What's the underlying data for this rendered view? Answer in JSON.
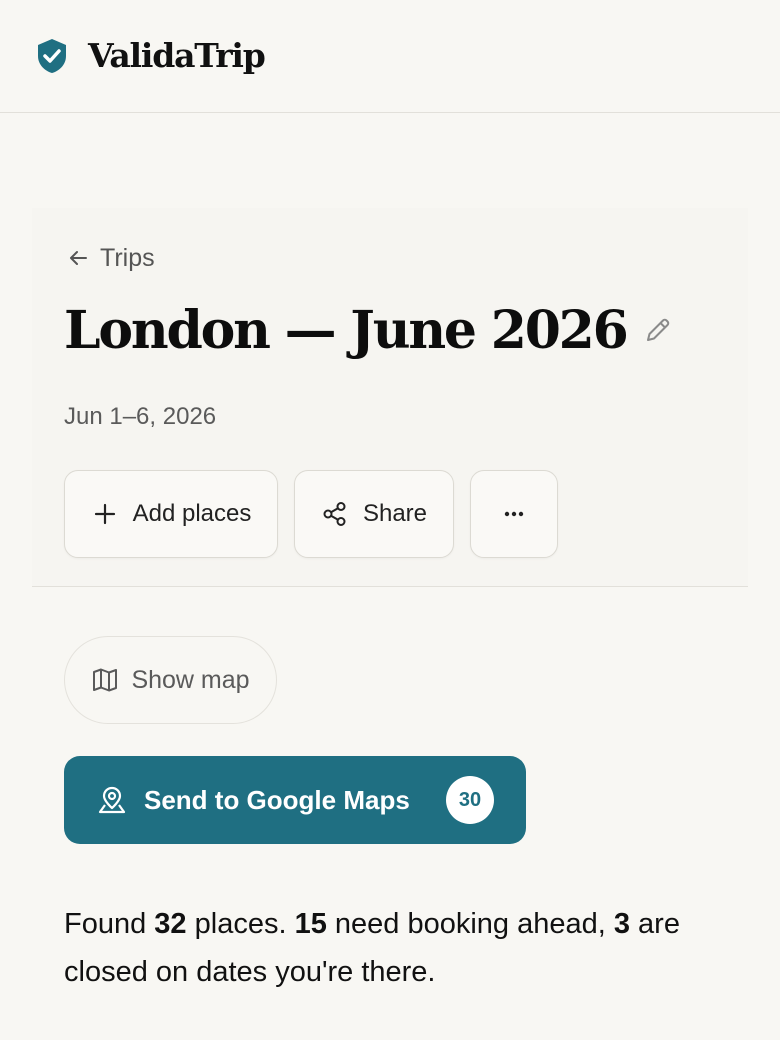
{
  "app": {
    "name": "ValidaTrip",
    "brand_color": "#1f6f82"
  },
  "nav": {
    "back_label": "Trips"
  },
  "trip": {
    "title": "London — June 2026",
    "dates": "Jun 1–6, 2026"
  },
  "actions": {
    "add_places": "Add places",
    "share": "Share",
    "more": "more-options"
  },
  "map": {
    "show_map_label": "Show map"
  },
  "send": {
    "label": "Send to Google Maps",
    "count": "30"
  },
  "summary": {
    "part1": "Found ",
    "places_count": "32",
    "part2": " places. ",
    "booking_count": "15",
    "part3": " need booking ahead, ",
    "closed_count": "3",
    "part4": " are closed on dates you're there."
  }
}
